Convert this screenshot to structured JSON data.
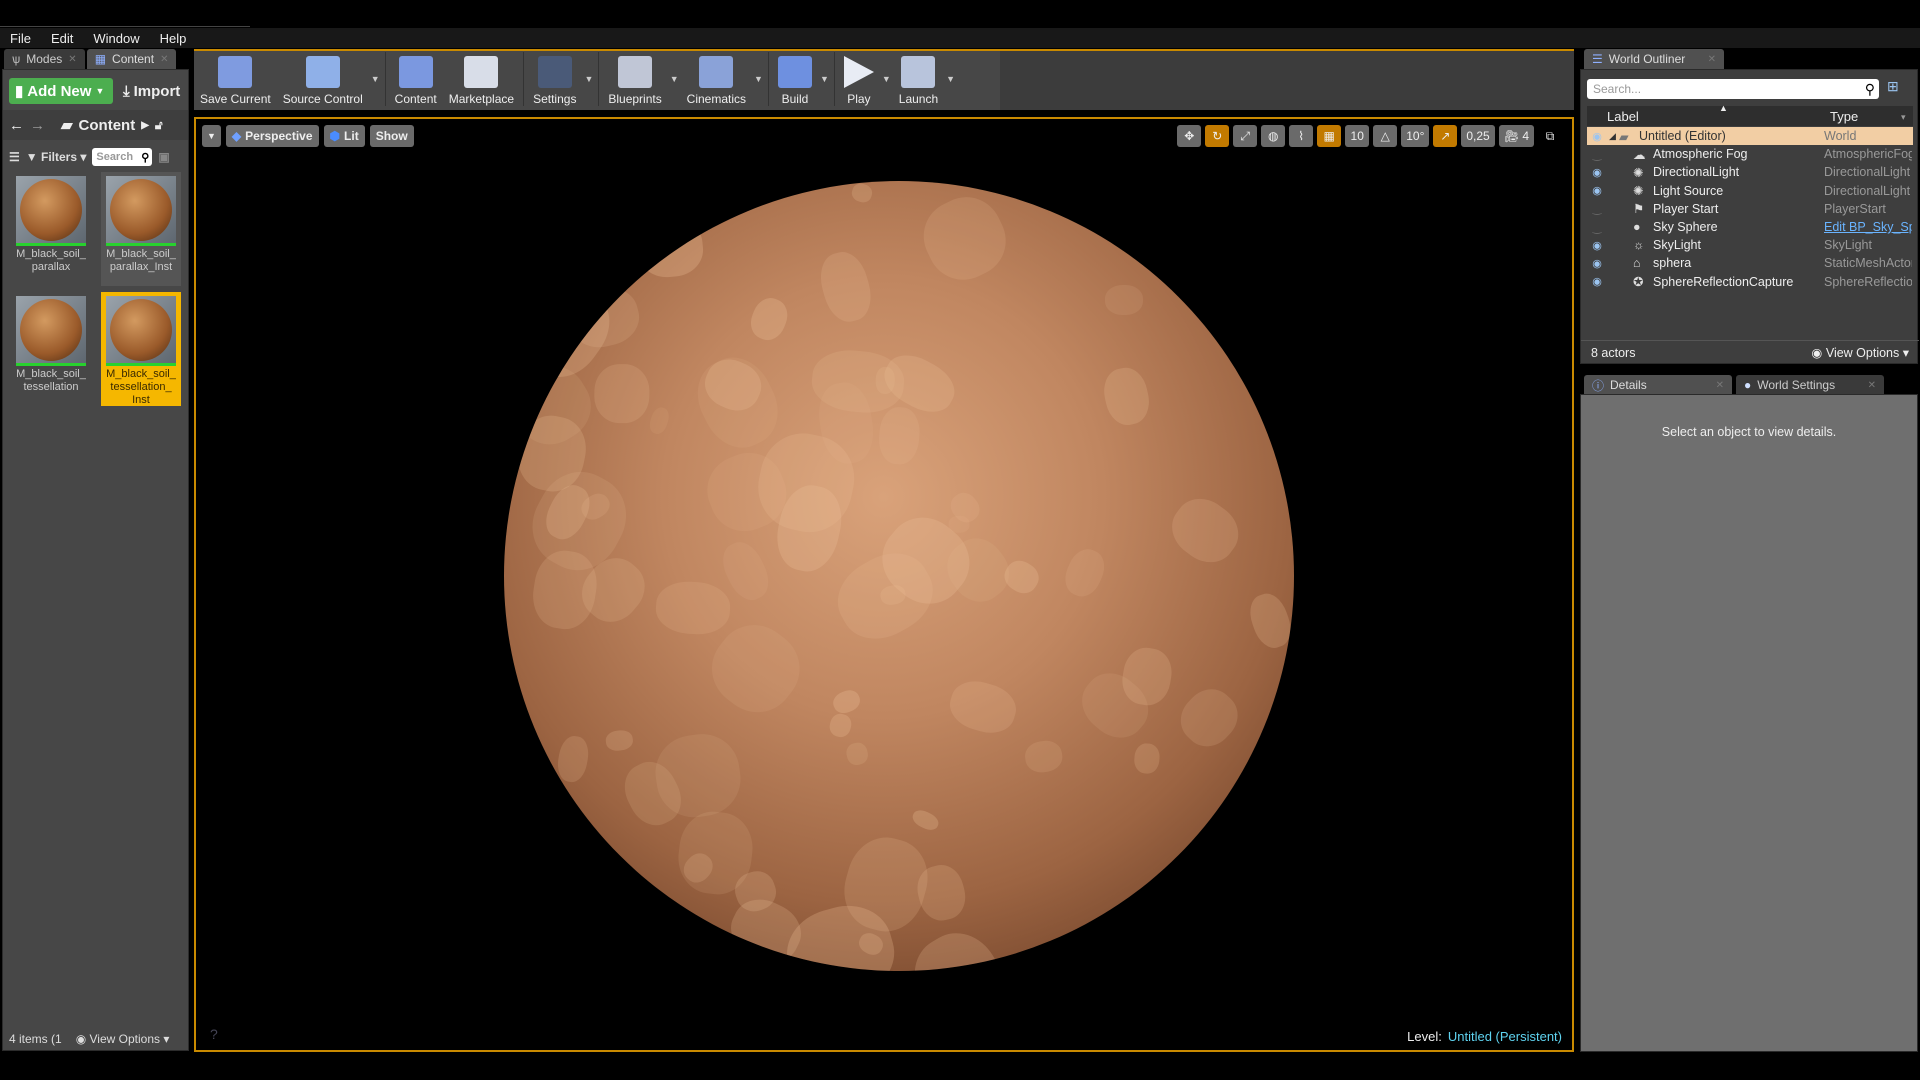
{
  "menu": [
    "File",
    "Edit",
    "Window",
    "Help"
  ],
  "left_tabs": [
    {
      "label": "Modes"
    },
    {
      "label": "Content"
    }
  ],
  "content_browser": {
    "add_new": "Add New",
    "import": "Import",
    "path": "Content",
    "filters": "Filters",
    "search_placeholder": "Search",
    "assets": [
      {
        "name": "M_black_soil_ parallax"
      },
      {
        "name": "M_black_soil_ parallax_Inst"
      },
      {
        "name": "M_black_soil_ tessellation"
      },
      {
        "name": "M_black_soil_ tessellation_ Inst",
        "selected": true
      }
    ],
    "item_count": "4 items (1",
    "view_options": "View Options"
  },
  "toolbar": [
    {
      "label": "Save Current",
      "icon": "save-icon",
      "color": "#7f9be0"
    },
    {
      "label": "Source Control",
      "icon": "source-control-icon",
      "color": "#8fb0e8"
    },
    {
      "label": "Content",
      "icon": "content-icon",
      "color": "#7b98e0"
    },
    {
      "label": "Marketplace",
      "icon": "marketplace-icon",
      "color": "#d8dde8"
    },
    {
      "label": "Settings",
      "icon": "settings-icon",
      "color": "#4a5a78"
    },
    {
      "label": "Blueprints",
      "icon": "blueprints-icon",
      "color": "#c0c6d6"
    },
    {
      "label": "Cinematics",
      "icon": "cinematics-icon",
      "color": "#8aa2d8"
    },
    {
      "label": "Build",
      "icon": "build-icon",
      "color": "#6e90e0"
    },
    {
      "label": "Play",
      "icon": "play-icon",
      "color": "#e8ecf4"
    },
    {
      "label": "Launch",
      "icon": "launch-icon",
      "color": "#b8c4dc"
    }
  ],
  "viewport": {
    "view_mode": "Perspective",
    "lighting": "Lit",
    "show": "Show",
    "grid_snap": "10",
    "rotation_snap": "10°",
    "scale_snap": "0,25",
    "camera_speed": "4",
    "level_label": "Level:",
    "level_name": "Untitled (Persistent)",
    "accent": "#c98a00"
  },
  "outliner": {
    "tab": "World Outliner",
    "search_placeholder": "Search...",
    "col_label": "Label",
    "col_type": "Type",
    "rows": [
      {
        "label": "Untitled (Editor)",
        "type": "World",
        "visible": true
      },
      {
        "label": "Atmospheric Fog",
        "type": "AtmosphericFog",
        "visible": false
      },
      {
        "label": "DirectionalLight",
        "type": "DirectionalLight",
        "visible": true
      },
      {
        "label": "Light Source",
        "type": "DirectionalLight",
        "visible": true
      },
      {
        "label": "Player Start",
        "type": "PlayerStart",
        "visible": false
      },
      {
        "label": "Sky Sphere",
        "type": "Edit BP_Sky_Sphere",
        "visible": false
      },
      {
        "label": "SkyLight",
        "type": "SkyLight",
        "visible": true
      },
      {
        "label": "sphera",
        "type": "StaticMeshActor",
        "visible": true
      },
      {
        "label": "SphereReflectionCapture",
        "type": "SphereReflectionCapture",
        "visible": true
      }
    ],
    "count": "8 actors",
    "view_options": "View Options"
  },
  "details": {
    "tabs": [
      "Details",
      "World Settings"
    ],
    "message": "Select an object to view details."
  }
}
